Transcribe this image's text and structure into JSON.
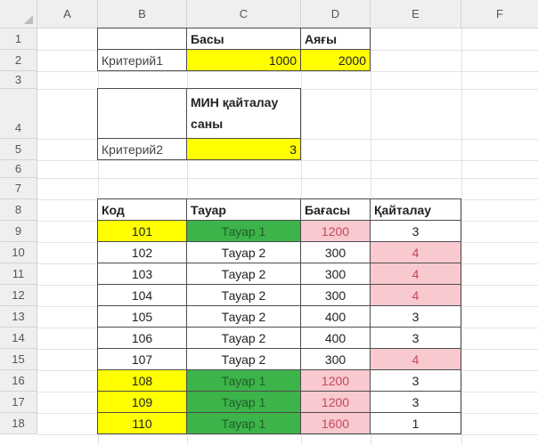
{
  "columns": [
    "A",
    "B",
    "C",
    "D",
    "E",
    "F"
  ],
  "rows": [
    "1",
    "2",
    "3",
    "4",
    "5",
    "6",
    "7",
    "8",
    "9",
    "10",
    "11",
    "12",
    "13",
    "14",
    "15",
    "16",
    "17",
    "18"
  ],
  "criteria": {
    "start_header": "Басы",
    "end_header": "Аяғы",
    "criteria1_label": "Критерий1",
    "start_value": "1000",
    "end_value": "2000",
    "min_repeat_header": "МИН қайталау саны",
    "criteria2_label": "Критерий2",
    "min_repeat_value": "3"
  },
  "table": {
    "headers": [
      "Код",
      "Тауар",
      "Бағасы",
      "Қайталау"
    ],
    "rows": [
      [
        "101",
        "Тауар 1",
        "1200",
        "3"
      ],
      [
        "102",
        "Тауар 2",
        "300",
        "4"
      ],
      [
        "103",
        "Тауар 2",
        "300",
        "4"
      ],
      [
        "104",
        "Тауар 2",
        "300",
        "4"
      ],
      [
        "105",
        "Тауар 2",
        "400",
        "3"
      ],
      [
        "106",
        "Тауар 2",
        "400",
        "3"
      ],
      [
        "107",
        "Тауар 2",
        "300",
        "4"
      ],
      [
        "108",
        "Тауар 1",
        "1200",
        "3"
      ],
      [
        "109",
        "Тауар 1",
        "1200",
        "3"
      ],
      [
        "110",
        "Тауар 1",
        "1600",
        "1"
      ]
    ],
    "highlight_rows": [
      0,
      7,
      8,
      9
    ],
    "highlight_repeat": [
      1,
      2,
      3,
      6
    ],
    "colors": {
      "yellow": "#ffff00",
      "green": "#3cb449",
      "pink": "#f8c9cf"
    }
  }
}
